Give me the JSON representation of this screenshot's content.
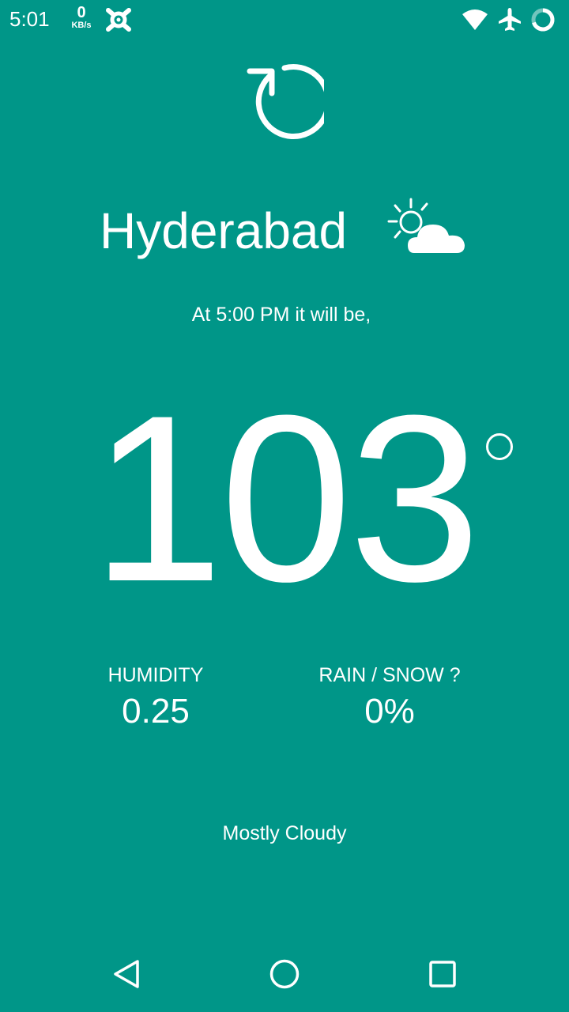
{
  "status_bar": {
    "time": "5:01",
    "net_speed_value": "0",
    "net_speed_unit": "KB/s",
    "icons": [
      "vpn-icon",
      "wifi-icon",
      "airplane-icon",
      "sync-icon"
    ]
  },
  "main": {
    "refresh_icon": "refresh-icon",
    "city": "Hyderabad",
    "weather_icon": "partly-cloudy-icon",
    "forecast_time": "At 5:00 PM it will be,",
    "temperature": "103",
    "humidity": {
      "label": "HUMIDITY",
      "value": "0.25"
    },
    "precipitation": {
      "label": "RAIN / SNOW ?",
      "value": "0%"
    },
    "condition": "Mostly Cloudy"
  },
  "nav_bar": {
    "icons": [
      "back-icon",
      "home-icon",
      "recents-icon"
    ]
  },
  "colors": {
    "background": "#009688",
    "foreground": "#ffffff"
  }
}
